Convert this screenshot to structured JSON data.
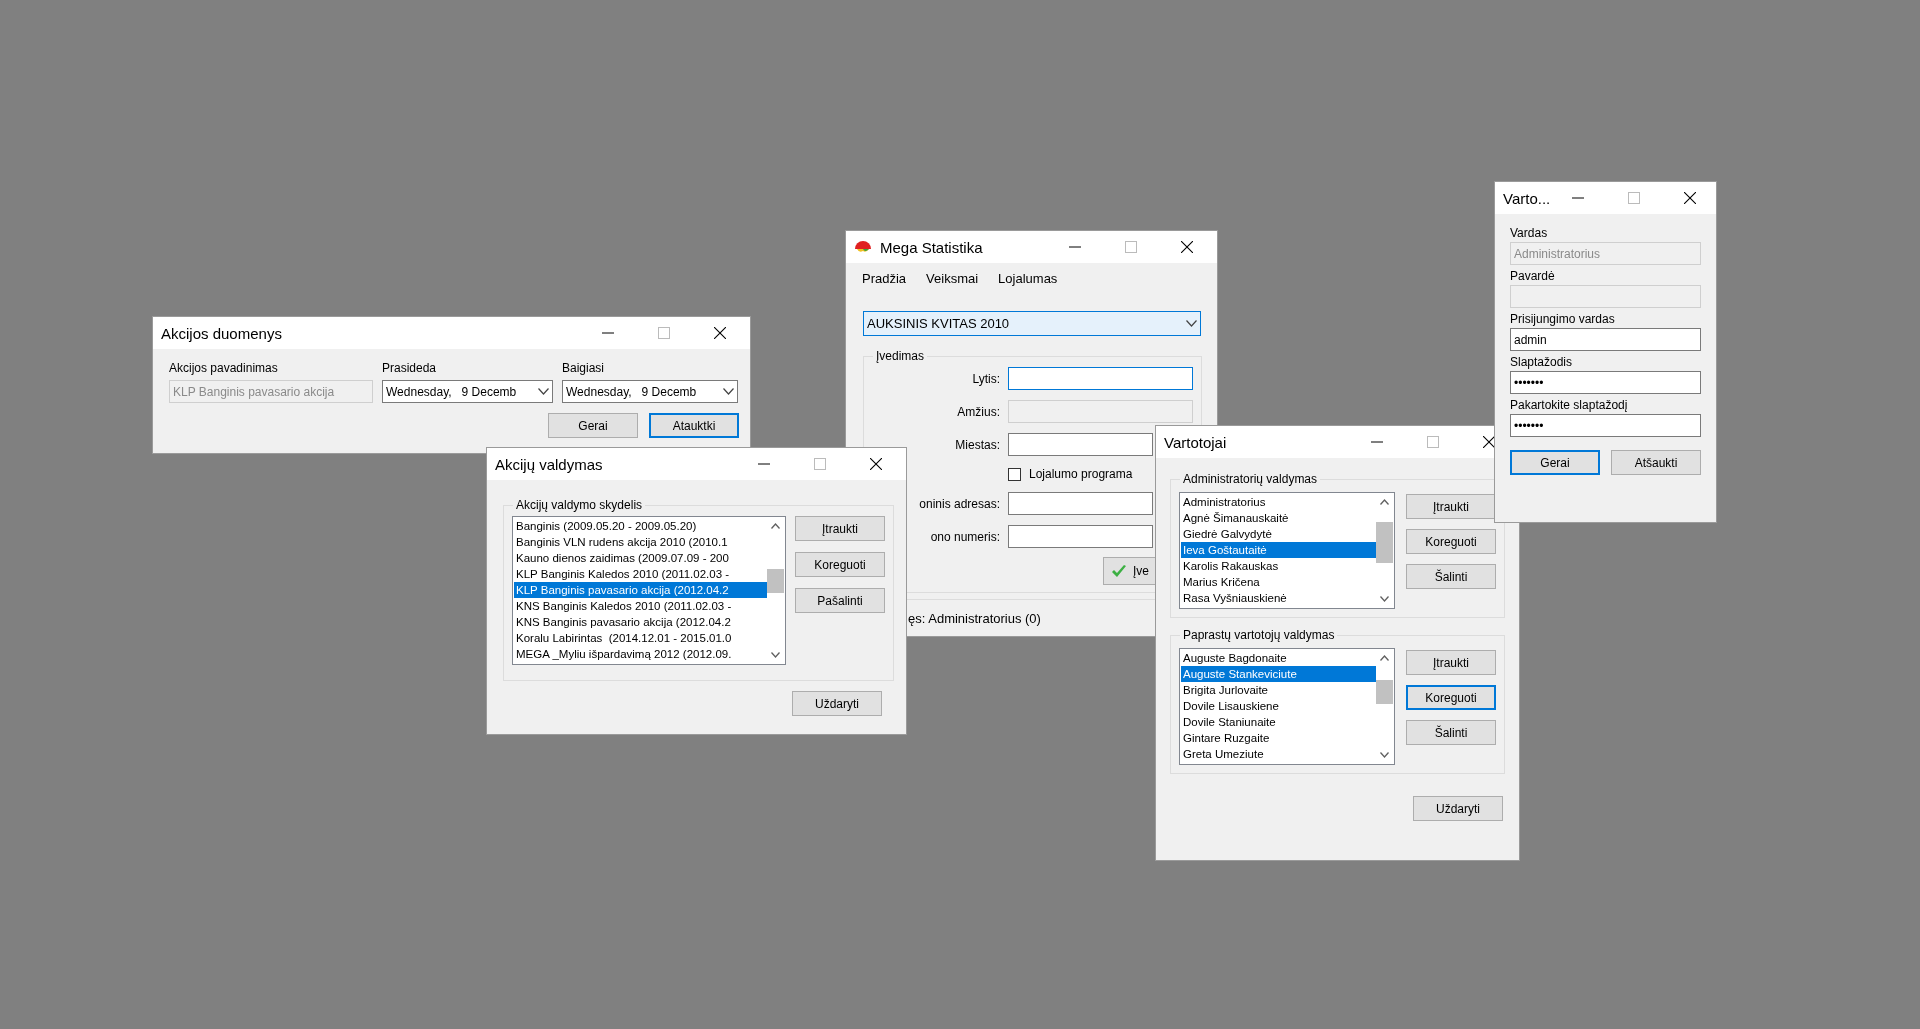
{
  "promo_details_window": {
    "title": "Akcijos duomenys",
    "name_label": "Akcijos pavadinimas",
    "name_field": {
      "value": "KLP Banginis pavasario akcija",
      "disabled": true
    },
    "start_label": "Prasideda",
    "start_date": "Wednesday,   9 Decemb",
    "end_label": "Baigiasi",
    "end_date": "Wednesday,   9 Decemb",
    "buttons": [
      {
        "label": "Gerai",
        "focused": false
      },
      {
        "label": "Atauktki",
        "focused": true
      }
    ]
  },
  "main_window": {
    "title": "Mega Statistika",
    "menu": [
      "Pradžia",
      "Veiksmai",
      "Lojalumas"
    ],
    "campaign_select": "AUKSINIS KVITAS 2010",
    "group_title": "Įvedimas",
    "fields": [
      {
        "kind": "text",
        "label": "Lytis:",
        "focused": true,
        "disabled": false
      },
      {
        "kind": "text",
        "label": "Amžius:",
        "focused": false,
        "disabled": true
      },
      {
        "kind": "text",
        "label": "Miestas:",
        "focused": false,
        "disabled": false
      },
      {
        "kind": "checkbox",
        "label": "Lojalumo programa",
        "checked": false
      },
      {
        "kind": "text",
        "label": "oninis adresas:",
        "focused": false,
        "disabled": false
      },
      {
        "kind": "text",
        "label": "ono numeris:",
        "focused": false,
        "disabled": false
      }
    ],
    "submit_button": "Įve",
    "status": "ęs: Administratorius (0)"
  },
  "promo_management_window": {
    "title": "Akcijų valdymas",
    "group_title": "Akcijų valdymo skydelis",
    "items": [
      {
        "label": "Banginis (2009.05.20 - 2009.05.20)",
        "selected": false
      },
      {
        "label": "Banginis VLN rudens akcija 2010 (2010.1",
        "selected": false
      },
      {
        "label": "Kauno dienos zaidimas (2009.07.09 - 200",
        "selected": false
      },
      {
        "label": "KLP Banginis Kaledos 2010 (2011.02.03 -",
        "selected": false
      },
      {
        "label": "KLP Banginis pavasario akcija (2012.04.2",
        "selected": true
      },
      {
        "label": "KNS Banginis Kaledos 2010 (2011.02.03 -",
        "selected": false
      },
      {
        "label": "KNS Banginis pavasario akcija (2012.04.2",
        "selected": false
      },
      {
        "label": "Koralu Labirintas  (2014.12.01 - 2015.01.0",
        "selected": false
      },
      {
        "label": "MEGA _Myliu išpardavimą 2012 (2012.09.",
        "selected": false
      }
    ],
    "buttons": [
      {
        "label": "Įtraukti",
        "focused": false
      },
      {
        "label": "Koreguoti",
        "focused": false
      },
      {
        "label": "Pašalinti",
        "focused": false
      }
    ],
    "close_button": "Uždaryti"
  },
  "users_window": {
    "title": "Vartotojai",
    "groups": [
      {
        "title": "Administratorių valdymas",
        "items": [
          {
            "label": "Administratorius",
            "selected": false
          },
          {
            "label": "Agnė Šimanauskaitė",
            "selected": false
          },
          {
            "label": "Giedrė Galvydytė",
            "selected": false
          },
          {
            "label": "Ieva Goštautaitė",
            "selected": true
          },
          {
            "label": "Karolis Rakauskas",
            "selected": false
          },
          {
            "label": "Marius Kričena",
            "selected": false
          },
          {
            "label": "Rasa Vyšniauskienė",
            "selected": false
          }
        ],
        "buttons": [
          {
            "label": "Įtraukti",
            "focused": false
          },
          {
            "label": "Koreguoti",
            "focused": false
          },
          {
            "label": "Šalinti",
            "focused": false
          }
        ]
      },
      {
        "title": "Paprastų vartotojų valdymas",
        "items": [
          {
            "label": "Auguste Bagdonaite",
            "selected": false
          },
          {
            "label": "Auguste Stankeviciute",
            "selected": true
          },
          {
            "label": "Brigita Jurlovaite",
            "selected": false
          },
          {
            "label": "Dovile Lisauskiene",
            "selected": false
          },
          {
            "label": "Dovile Staniunaite",
            "selected": false
          },
          {
            "label": "Gintare Ruzgaite",
            "selected": false
          },
          {
            "label": "Greta Umeziute",
            "selected": false
          }
        ],
        "buttons": [
          {
            "label": "Įtraukti",
            "focused": false
          },
          {
            "label": "Koreguoti",
            "focused": true
          },
          {
            "label": "Šalinti",
            "focused": false
          }
        ]
      }
    ],
    "close_button": "Uždaryti"
  },
  "user_edit_window": {
    "title": "Varto...",
    "fields": [
      {
        "label": "Vardas",
        "value": "Administratorius",
        "disabled": true
      },
      {
        "label": "Pavardė",
        "disabled": true
      },
      {
        "label": "Prisijungimo vardas",
        "value": "admin",
        "disabled": false
      },
      {
        "label": "Slaptažodis",
        "value": "•••••••",
        "disabled": false
      },
      {
        "label": "Pakartokite slaptažodį",
        "value": "•••••••",
        "disabled": false
      }
    ],
    "buttons": [
      {
        "label": "Gerai",
        "focused": true
      },
      {
        "label": "Atšaukti",
        "focused": false
      }
    ]
  }
}
